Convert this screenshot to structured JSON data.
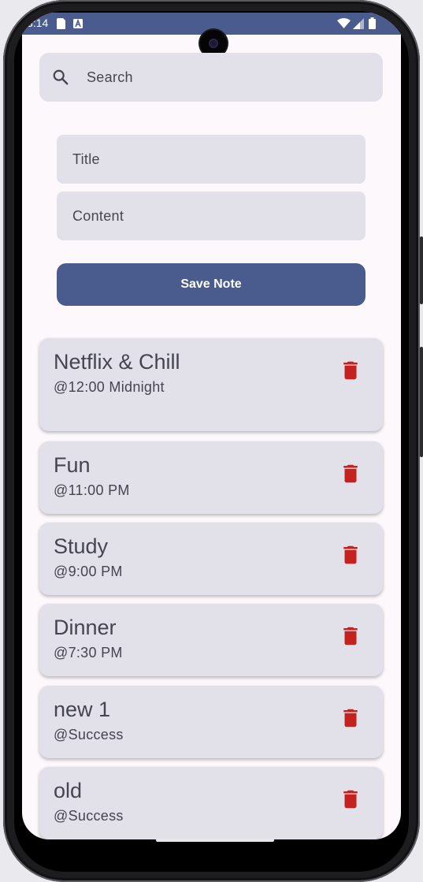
{
  "status_bar": {
    "time": "3:14",
    "background": "#4a5b8e",
    "left_icons": [
      "sim-card-icon",
      "a-badge-icon"
    ],
    "right_icons": [
      "wifi-icon",
      "cellular-signal-icon",
      "battery-icon"
    ]
  },
  "search": {
    "icon": "search-icon",
    "placeholder": "Search",
    "value": ""
  },
  "form": {
    "title_placeholder": "Title",
    "content_placeholder": "Content",
    "save_label": "Save Note"
  },
  "notes": [
    {
      "title": "Netflix & Chill",
      "subtitle": "@12:00 Midnight"
    },
    {
      "title": "Fun",
      "subtitle": "@11:00 PM"
    },
    {
      "title": "Study",
      "subtitle": "@9:00 PM"
    },
    {
      "title": "Dinner",
      "subtitle": "@7:30 PM"
    },
    {
      "title": "new 1",
      "subtitle": "@Success"
    },
    {
      "title": "old",
      "subtitle": "@Success"
    }
  ],
  "colors": {
    "primary": "#4a5b8e",
    "surface": "#fcf8fc",
    "card": "#e2e1ea",
    "delete": "#c5221f",
    "text": "#45454f"
  },
  "icons": {
    "delete": "trash-icon"
  }
}
